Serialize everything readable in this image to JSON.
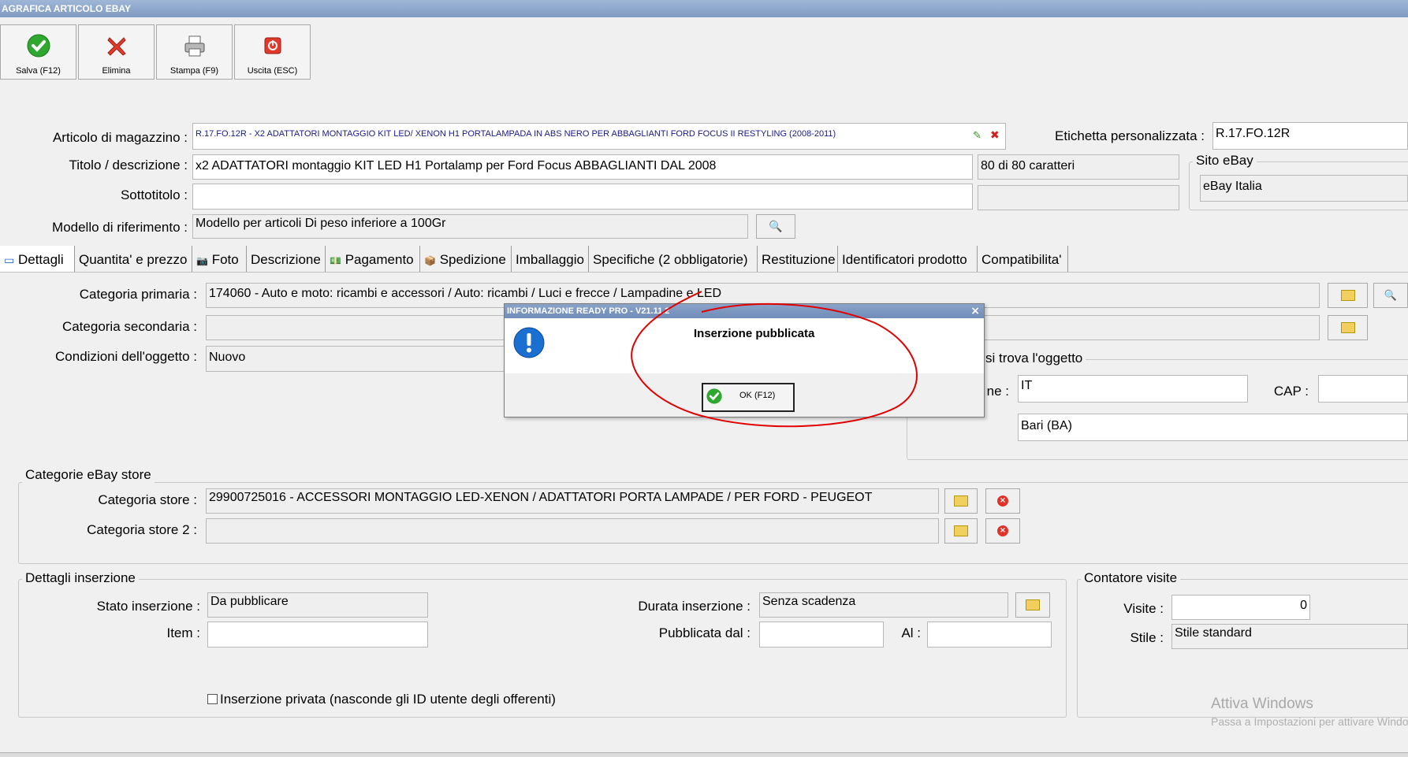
{
  "window": {
    "title": "AGRAFICA ARTICOLO EBAY"
  },
  "toolbar": {
    "save_label": "Salva (F12)",
    "delete_label": "Elimina",
    "print_label": "Stampa (F9)",
    "exit_label": "Uscita (ESC)"
  },
  "header": {
    "articolo_label": "Articolo di magazzino :",
    "articolo_value": "R.17.FO.12R - X2 ADATTATORI MONTAGGIO KIT LED/ XENON H1 PORTALAMPADA IN ABS NERO PER ABBAGLIANTI FORD FOCUS II RESTYLING (2008-2011)",
    "titolo_label": "Titolo / descrizione :",
    "titolo_value": "x2 ADATTATORI montaggio KIT LED H1 Portalamp per Ford Focus ABBAGLIANTI DAL 2008",
    "char_count": "80 di 80 caratteri",
    "sottotitolo_label": "Sottotitolo :",
    "sottotitolo_value": "",
    "modello_label": "Modello di riferimento :",
    "modello_value": "Modello per articoli Di peso inferiore a 100Gr",
    "etichetta_label": "Etichetta personalizzata :",
    "etichetta_value": "R.17.FO.12R",
    "sito_group": "Sito eBay",
    "sito_value": "eBay Italia"
  },
  "tabs": [
    "Dettagli",
    "Quantita' e prezzo",
    "Foto",
    "Descrizione",
    "Pagamento",
    "Spedizione",
    "Imballaggio",
    "Specifiche (2 obbligatorie)",
    "Restituzione",
    "Identificatori prodotto",
    "Compatibilita'"
  ],
  "details": {
    "cat_primaria_label": "Categoria primaria :",
    "cat_primaria_value": "174060 - Auto e moto: ricambi e accessori / Auto: ricambi / Luci e frecce / Lampadine e LED",
    "cat_secondaria_label": "Categoria secondaria :",
    "cat_secondaria_value": "",
    "condizioni_label": "Condizioni dell'oggetto :",
    "condizioni_value": "Nuovo",
    "location_group": "si trova l'oggetto",
    "nazione_label": "ne :",
    "nazione_value": "IT",
    "cap_label": "CAP :",
    "cap_value": "",
    "luogo_value": "Bari (BA)"
  },
  "store": {
    "group": "Categorie eBay store",
    "cat_store_label": "Categoria store :",
    "cat_store_value": "29900725016 - ACCESSORI MONTAGGIO LED-XENON / ADATTATORI PORTA LAMPADE / PER FORD - PEUGEOT",
    "cat_store2_label": "Categoria store 2 :",
    "cat_store2_value": ""
  },
  "inserzione": {
    "group": "Dettagli inserzione",
    "stato_label": "Stato inserzione :",
    "stato_value": "Da pubblicare",
    "item_label": "Item :",
    "item_value": "",
    "durata_label": "Durata inserzione :",
    "durata_value": "Senza scadenza",
    "pubblicata_label": "Pubblicata dal :",
    "pubblicata_value": "",
    "al_label": "Al :",
    "al_value": "",
    "privata_label": "Inserzione privata (nasconde gli ID utente degli offerenti)"
  },
  "contatore": {
    "group": "Contatore visite",
    "visite_label": "Visite :",
    "visite_value": "0",
    "stile_label": "Stile :",
    "stile_value": "Stile standard"
  },
  "dialog": {
    "title": "INFORMAZIONE READY PRO - V21.11.2",
    "message": "Inserzione pubblicata",
    "ok_label": "OK (F12)",
    "close_glyph": "×"
  },
  "watermark": {
    "line1": "Attiva Windows",
    "line2": "Passa a Impostazioni per attivare Windows."
  },
  "colors": {
    "title_bar": "#8aa3c8",
    "annotation": "#e00000",
    "link_text": "#1a1a8c"
  }
}
